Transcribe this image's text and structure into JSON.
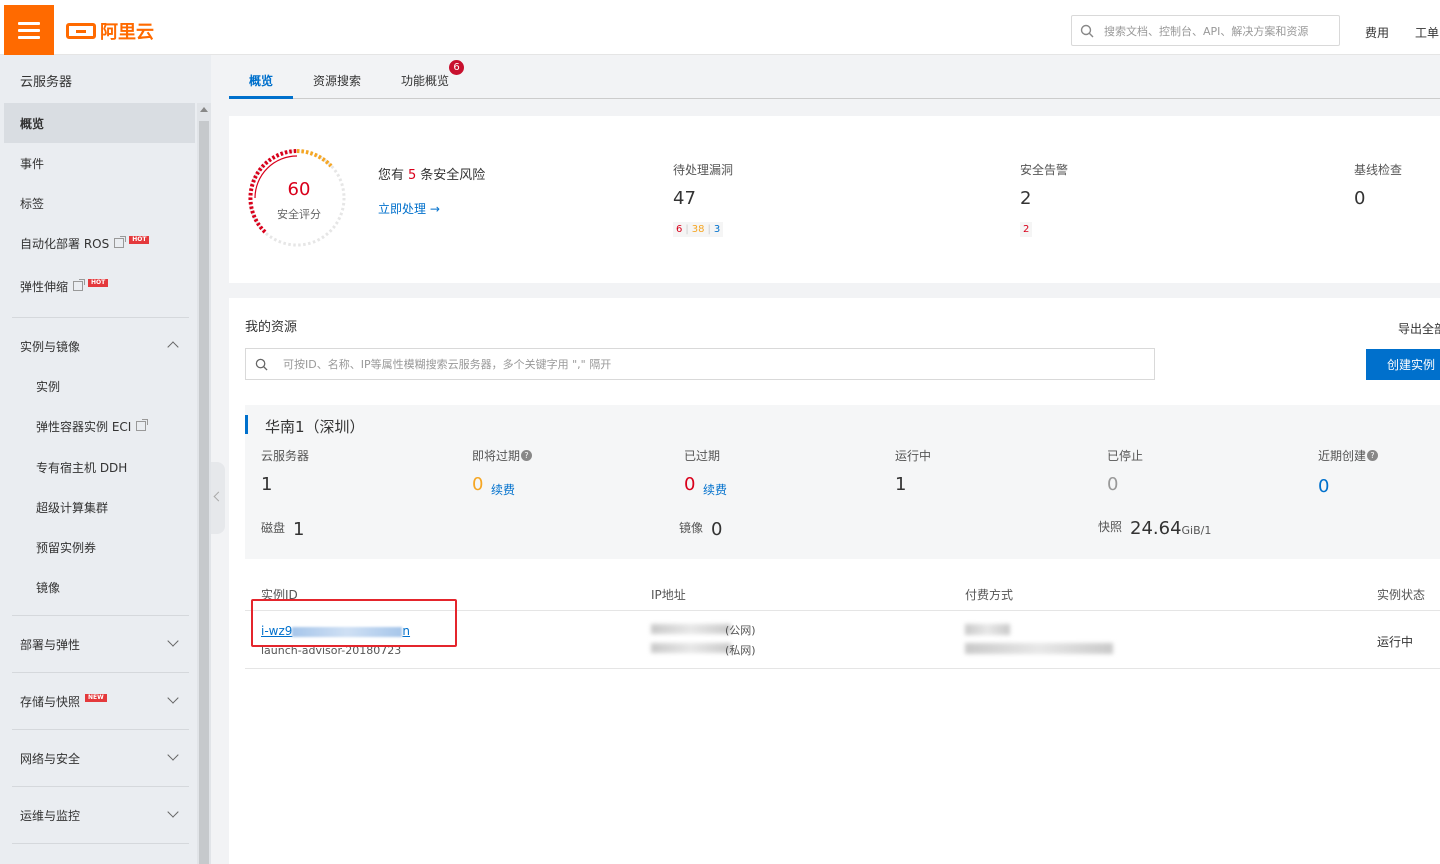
{
  "header": {
    "logo_text": "阿里云",
    "search_placeholder": "搜索文档、控制台、API、解决方案和资源",
    "links": [
      "费用",
      "工单"
    ]
  },
  "sidebar": {
    "title": "云服务器",
    "items": [
      {
        "label": "概览",
        "active": true
      },
      {
        "label": "事件"
      },
      {
        "label": "标签"
      },
      {
        "label": "自动化部署 ROS",
        "badge": "HOT"
      },
      {
        "label": "弹性伸缩",
        "badge": "HOT"
      }
    ],
    "group_instances": {
      "label": "实例与镜像",
      "children": [
        "实例",
        "弹性容器实例 ECI",
        "专有宿主机 DDH",
        "超级计算集群",
        "预留实例券",
        "镜像"
      ]
    },
    "groups": [
      {
        "label": "部署与弹性"
      },
      {
        "label": "存储与快照",
        "badge": "NEW"
      },
      {
        "label": "网络与安全"
      },
      {
        "label": "运维与监控"
      }
    ]
  },
  "tabs": [
    {
      "label": "概览",
      "active": true
    },
    {
      "label": "资源搜索"
    },
    {
      "label": "功能概览",
      "badge": "6"
    }
  ],
  "security": {
    "score": "60",
    "score_label": "安全评分",
    "risk_prefix": "您有",
    "risk_count": "5",
    "risk_suffix": "条安全风险",
    "action": "立即处理",
    "vuln_label": "待处理漏洞",
    "vuln_value": "47",
    "vuln_breakdown": [
      "6",
      "38",
      "3"
    ],
    "alert_label": "安全告警",
    "alert_value": "2",
    "alert_breakdown": [
      "2"
    ],
    "baseline_label": "基线检查",
    "baseline_value": "0"
  },
  "resources": {
    "title": "我的资源",
    "export": "导出全部",
    "search_placeholder": "可按ID、名称、IP等属性模糊搜索云服务器，多个关键字用 \",\" 隔开",
    "create_button": "创建实例",
    "region": "华南1（深圳）",
    "stats": {
      "servers_label": "云服务器",
      "servers": "1",
      "expiring_label": "即将过期",
      "expiring": "0",
      "expired_label": "已过期",
      "expired": "0",
      "running_label": "运行中",
      "running": "1",
      "stopped_label": "已停止",
      "stopped": "0",
      "recent_label": "近期创建",
      "recent": "0",
      "renew": "续费",
      "disk_label": "磁盘",
      "disk": "1",
      "image_label": "镜像",
      "image": "0",
      "snapshot_label": "快照",
      "snapshot": "24.64",
      "snapshot_unit": "GiB/1"
    },
    "table": {
      "headers": [
        "实例ID",
        "IP地址",
        "付费方式",
        "实例状态"
      ],
      "row": {
        "id_prefix": "i-wz9",
        "id_suffix": "n",
        "name": "launch-advisor-20180723",
        "ip_public_suffix": "(公网)",
        "ip_private_suffix": "(私网)",
        "status": "运行中"
      }
    }
  },
  "colors": {
    "accent": "#ff6a00",
    "link": "#0070cc",
    "danger": "#d9001b",
    "warn": "#f5a623"
  }
}
